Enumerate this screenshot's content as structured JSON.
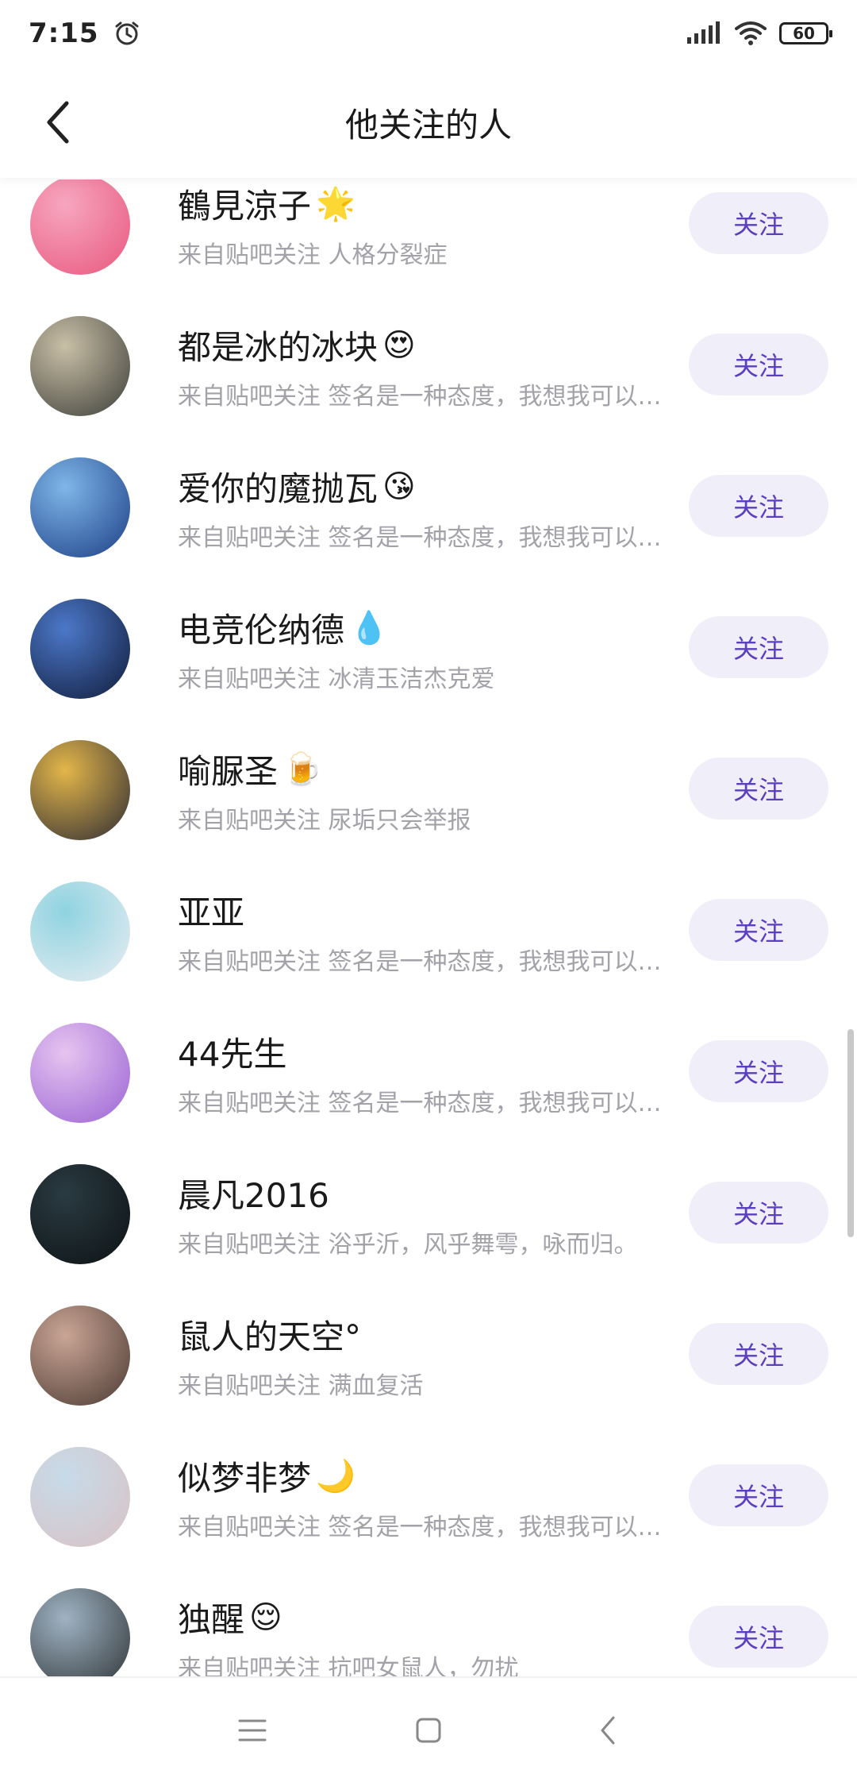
{
  "status_bar": {
    "time": "7:15",
    "battery": "60",
    "icons": [
      "alarm-icon",
      "signal-icon",
      "wifi-icon",
      "battery-icon"
    ]
  },
  "header": {
    "title": "他关注的人",
    "back_icon": "back-arrow-icon"
  },
  "follow_label": "关注",
  "users": [
    {
      "name": "鶴見涼子",
      "emoji": "🌟",
      "subtitle": "来自贴吧关注 人格分裂症",
      "avatar_colors": [
        "#f7a6c0",
        "#e8587d"
      ]
    },
    {
      "name": "都是冰的冰块",
      "emoji": "😍",
      "subtitle": "来自贴吧关注 签名是一种态度，我想我可以更酷...",
      "avatar_colors": [
        "#c9bfa6",
        "#3d3f3a"
      ]
    },
    {
      "name": "爱你的魔抛瓦",
      "emoji": "😘",
      "subtitle": "来自贴吧关注 签名是一种态度，我想我可以更酷...",
      "avatar_colors": [
        "#7fb6e8",
        "#1c3f86"
      ]
    },
    {
      "name": "电竞伦纳德",
      "emoji": "💧",
      "subtitle": "来自贴吧关注 冰清玉洁杰克爱",
      "avatar_colors": [
        "#4c78c9",
        "#101c3a"
      ]
    },
    {
      "name": "喻脲圣",
      "emoji": "🍺",
      "subtitle": "来自贴吧关注 尿垢只会举报",
      "avatar_colors": [
        "#e3b64a",
        "#2e2c34"
      ]
    },
    {
      "name": "亚亚",
      "emoji": "",
      "subtitle": "来自贴吧关注 签名是一种态度，我想我可以更酷...",
      "avatar_colors": [
        "#8fd3e0",
        "#e9edf2"
      ]
    },
    {
      "name": "44先生",
      "emoji": "",
      "subtitle": "来自贴吧关注 签名是一种态度，我想我可以更酷...",
      "avatar_colors": [
        "#e6c4f0",
        "#9a64d4"
      ]
    },
    {
      "name": "晨凡2016",
      "emoji": "",
      "subtitle": "来自贴吧关注 浴乎沂，风乎舞雩，咏而归。",
      "avatar_colors": [
        "#2a3b42",
        "#0d1214"
      ]
    },
    {
      "name": "鼠人的天空°",
      "emoji": "",
      "subtitle": "来自贴吧关注 满血复活",
      "avatar_colors": [
        "#caa595",
        "#4b3a33"
      ]
    },
    {
      "name": "似梦非梦",
      "emoji": "🌙",
      "subtitle": "来自贴吧关注 签名是一种态度，我想我可以更酷...",
      "avatar_colors": [
        "#c7dbe9",
        "#d9c2c5"
      ]
    },
    {
      "name": "独醒",
      "emoji": "😌",
      "subtitle": "来自贴吧关注 抗吧女鼠人，勿扰",
      "avatar_colors": [
        "#9fb3c3",
        "#2f3436"
      ]
    }
  ],
  "nav_bar": {
    "icons": [
      "menu-icon",
      "home-square-icon",
      "back-icon"
    ]
  }
}
